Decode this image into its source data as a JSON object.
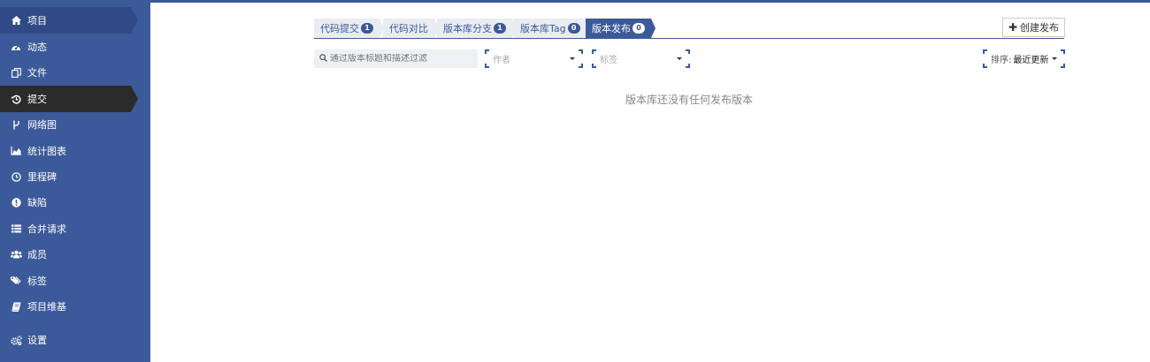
{
  "sidebar": {
    "items": [
      {
        "label": "项目",
        "icon": "home-icon"
      },
      {
        "label": "动态",
        "icon": "dashboard-icon"
      },
      {
        "label": "文件",
        "icon": "files-icon"
      },
      {
        "label": "提交",
        "icon": "history-icon"
      },
      {
        "label": "网络图",
        "icon": "branch-icon"
      },
      {
        "label": "统计图表",
        "icon": "area-chart-icon"
      },
      {
        "label": "里程碑",
        "icon": "clock-icon"
      },
      {
        "label": "缺陷",
        "icon": "exclamation-icon"
      },
      {
        "label": "合并请求",
        "icon": "list-icon"
      },
      {
        "label": "成员",
        "icon": "users-icon"
      },
      {
        "label": "标签",
        "icon": "tags-icon"
      },
      {
        "label": "项目维基",
        "icon": "book-icon"
      },
      {
        "label": "设置",
        "icon": "cogs-icon"
      }
    ]
  },
  "tabs": [
    {
      "label": "代码提交",
      "badge": "1"
    },
    {
      "label": "代码对比",
      "badge": ""
    },
    {
      "label": "版本库分支",
      "badge": "1"
    },
    {
      "label": "版本库Tag",
      "badge": "0"
    },
    {
      "label": "版本发布",
      "badge": "0"
    }
  ],
  "toolbar": {
    "create_label": "创建发布"
  },
  "filters": {
    "search_placeholder": "通过版本标题和描述过滤",
    "author_placeholder": "作者",
    "tag_placeholder": "标签",
    "sort_label": "排序:",
    "sort_value": "最近更新"
  },
  "empty_message": "版本库还没有任何发布版本",
  "colors": {
    "sidebar": "#3c5a99",
    "active_item": "#2b2b2b",
    "accent": "#3c5a99"
  }
}
